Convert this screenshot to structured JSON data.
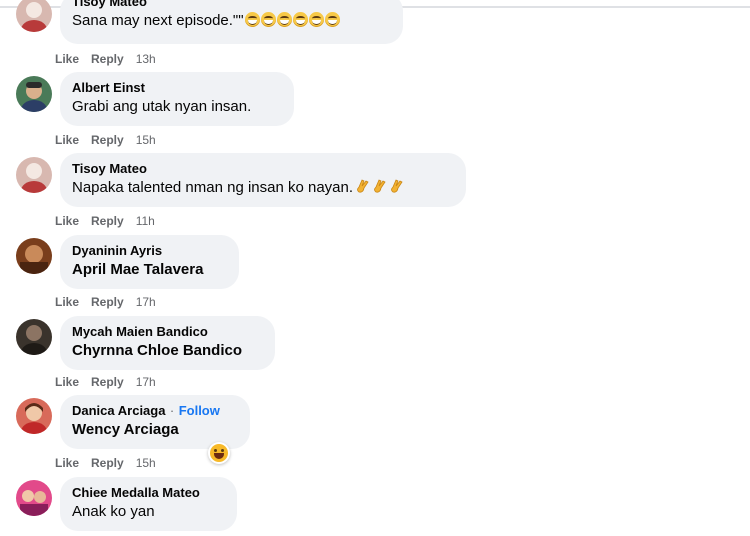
{
  "labels": {
    "like": "Like",
    "reply": "Reply",
    "follow": "Follow",
    "follow_sep": "·"
  },
  "comments": [
    {
      "author": "Tisoy Mateo",
      "text": "Sana may next episode.\"\"",
      "emoji_count": 6,
      "emoji": "grinning-face",
      "time": "13h"
    },
    {
      "author": "Albert Einst",
      "text": "Grabi ang utak nyan insan.",
      "time": "15h"
    },
    {
      "author": "Tisoy Mateo",
      "text": "Napaka talented nman ng insan ko nayan.",
      "emoji_count": 3,
      "emoji": "clapping-hands",
      "time": "11h"
    },
    {
      "author": "Dyaninin Ayris",
      "text": "April Mae Talavera",
      "time": "17h"
    },
    {
      "author": "Mycah Maien Bandico",
      "text": "Chyrnna Chloe Bandico",
      "time": "17h"
    },
    {
      "author": "Danica Arciaga",
      "text": "Wency Arciaga",
      "time": "15h",
      "reaction": "haha"
    },
    {
      "author": "Chiee Medalla Mateo",
      "text": "Anak ko yan"
    }
  ]
}
